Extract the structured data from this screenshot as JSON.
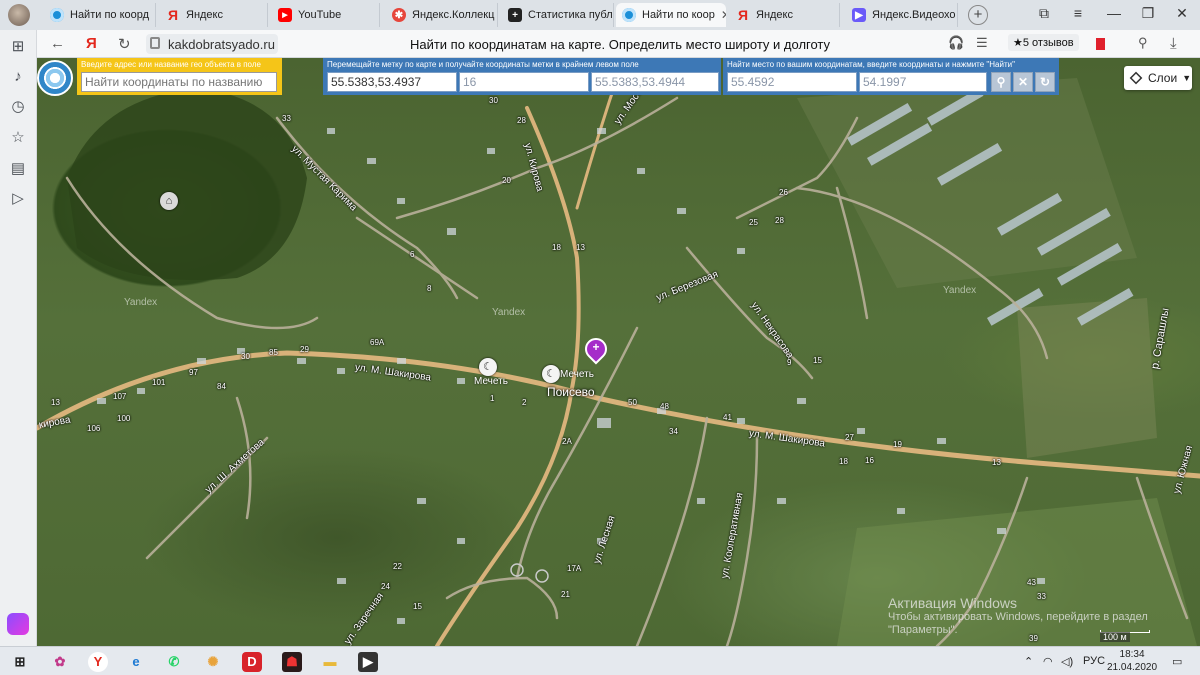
{
  "browser": {
    "tabs": [
      {
        "label": "Найти по коорд",
        "icon": "globe-icon"
      },
      {
        "label": "Яндекс",
        "icon": "yandex-icon"
      },
      {
        "label": "YouTube",
        "icon": "youtube-icon"
      },
      {
        "label": "Яндекс.Коллекц",
        "icon": "yandex-collections-icon"
      },
      {
        "label": "Статистика публ",
        "icon": "statistics-icon"
      },
      {
        "label": "Найти по коор",
        "icon": "globe-icon",
        "active": true
      },
      {
        "label": "Яндекс",
        "icon": "yandex-icon"
      },
      {
        "label": "Яндекс.Видеохо",
        "icon": "yandex-video-icon"
      }
    ],
    "url": "kakdobratsyado.ru",
    "page_title": "Найти по координатам на карте. Определить место широту и долготу",
    "reviews": "★5 отзывов"
  },
  "map_ui": {
    "search_hint": "Введите адрес или название гео объекта в поле",
    "search_placeholder": "Найти координаты по названию",
    "coord_hint": "Перемещайте метку по карте и получайте координаты метки в крайнем левом поле",
    "marker_coords": "55.5383,53.4937",
    "zoom": "16",
    "corner_coords": "55.5383,53.4944",
    "find_hint": "Найти место по вашим координатам, введите координаты и нажмите \"Найти\"",
    "lat": "55.4592",
    "lon": "54.1997",
    "layers_label": "Слои",
    "scale_label": "100 м"
  },
  "map_labels": {
    "village": "Поисево",
    "streets": [
      "ул. М. Шакирова",
      "ул. М. Шакирова",
      "ул. Кирова",
      "кирова",
      "ул. Мустая Карима",
      "ул. Мостовая",
      "ул. Березовая",
      "ул. Некрасова",
      "ул. Лесная",
      "ул. Кооперативная",
      "ул. Южная",
      "ул. Ш. Ахметова",
      "ул. Заречная"
    ],
    "pois": [
      "Мечеть",
      "Мечеть"
    ],
    "river": "р. Сарашлы",
    "watermark": "Yandex",
    "house_numbers": [
      "30",
      "28",
      "33",
      "20",
      "18",
      "6",
      "8",
      "85",
      "69А",
      "29",
      "30",
      "97",
      "101",
      "107",
      "84",
      "100",
      "106",
      "13",
      "2",
      "1",
      "50",
      "48",
      "34",
      "41",
      "18",
      "15",
      "13",
      "27",
      "19",
      "16",
      "2А",
      "17А",
      "21",
      "24",
      "15",
      "22",
      "28",
      "26",
      "25",
      "13",
      "39",
      "9",
      "43",
      "33"
    ]
  },
  "system": {
    "activation_title": "Активация Windows",
    "activation_text": "Чтобы активировать Windows, перейдите в раздел \"Параметры\".",
    "language": "РУС",
    "time": "18:34",
    "date": "21.04.2020"
  },
  "colors": {
    "search_panel": "#f5c518",
    "coord_panel": "#3d78b6",
    "pin": "#a52cc9",
    "road": "#d8b27a"
  }
}
